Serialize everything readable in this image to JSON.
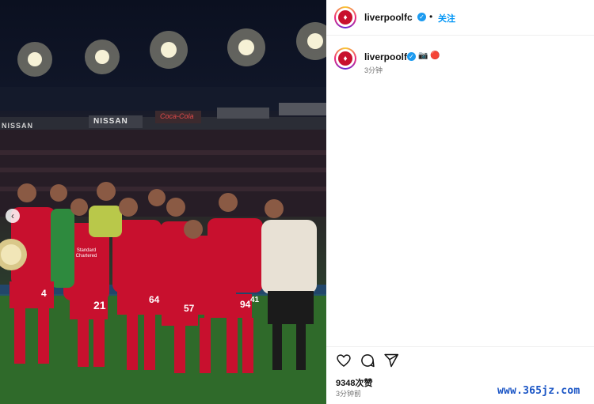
{
  "header": {
    "username": "liverpoolfc",
    "separator": "•",
    "follow_label": "关注"
  },
  "caption": {
    "username": "liverpoolfc",
    "emoji_text": "📷 🔴",
    "time": "3分钟"
  },
  "photo": {
    "stadium_signs": [
      "NISSAN",
      "Coca-Cola",
      "NISSAN"
    ],
    "shirt_sponsor": "Standard Chartered",
    "kit_color": "#c8102e",
    "shirt_numbers": [
      "4",
      "21",
      "64",
      "57",
      "94",
      "41"
    ]
  },
  "actions": {
    "icons": [
      "heart-icon",
      "comment-icon",
      "share-icon"
    ]
  },
  "likes": "9348次赞",
  "post_time": "3分钟前",
  "watermark": "www.365jz.com",
  "colors": {
    "accent": "#0095f6",
    "verified": "#1d9bf0",
    "brand_red": "#c8102e",
    "watermark": "#1a55c5"
  }
}
